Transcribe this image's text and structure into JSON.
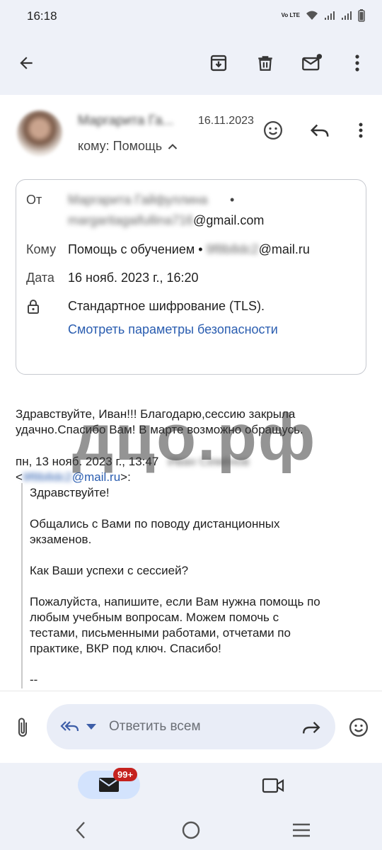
{
  "status_bar": {
    "time": "16:18",
    "network": "Vo LTE"
  },
  "header": {
    "sender_name": "Маргарита Га...",
    "date": "16.11.2023",
    "to_line": "кому: Помощь"
  },
  "details": {
    "from_label": "От",
    "from_name_blurred": "Маргарита Гайфуллина",
    "from_email_blurred": "margaritagaifullina716",
    "from_email_domain": "@gmail.com",
    "to_label": "Кому",
    "to_name": "Помощь с обучением",
    "to_email_blurred": "9f8b8dc2",
    "to_email_domain": "@mail.ru",
    "date_label": "Дата",
    "date_value": "16 нояб. 2023 г., 16:20",
    "encryption_text": "Стандартное шифрование (TLS).",
    "security_link": "Смотреть параметры безопасности"
  },
  "message": {
    "line1": "Здравствуйте, Иван!!! Благодарю,сессию закрыла",
    "line2": "удачно.Спасибо Вам! В марте возможно обращусь.",
    "quote_header_date": "пн, 13 нояб. 2023 г., 13:47",
    "quote_header_name_blurred": "Иван Семёнов",
    "quote_header_email_blurred": "9f8b8dc2",
    "quote_header_email_domain": "@mail.ru",
    "quote_greeting": "Здравствуйте!",
    "quote_p1_l1": "Общались с Вами по поводу дистанционных",
    "quote_p1_l2": "экзаменов.",
    "quote_p2": "Как Ваши успехи с сессией?",
    "quote_p3_l1": "Пожалуйста, напишите, если Вам нужна помощь по",
    "quote_p3_l2": "любым учебным вопросам. Можем помочь с",
    "quote_p3_l3": "тестами, письменными работами, отчетами по",
    "quote_p3_l4": "практике, ВКР под ключ. Спасибо!",
    "signature_sep": "--"
  },
  "watermark": "дцо.рф",
  "reply": {
    "placeholder": "Ответить всем"
  },
  "nav": {
    "mail_badge": "99+"
  },
  "icons": [
    "back-arrow-icon",
    "archive-icon",
    "delete-icon",
    "mark-unread-icon",
    "more-vert-icon",
    "emoji-icon",
    "reply-icon",
    "lock-icon",
    "chevron-up-icon",
    "attach-icon",
    "reply-all-icon",
    "forward-icon",
    "mail-icon",
    "video-icon",
    "nav-back-icon",
    "nav-home-icon",
    "nav-recents-icon"
  ],
  "colors": {
    "accent_link": "#2a5db0",
    "surface": "#eef1f8",
    "badge": "#c5221f",
    "selected_nav": "#d3e3fd"
  }
}
